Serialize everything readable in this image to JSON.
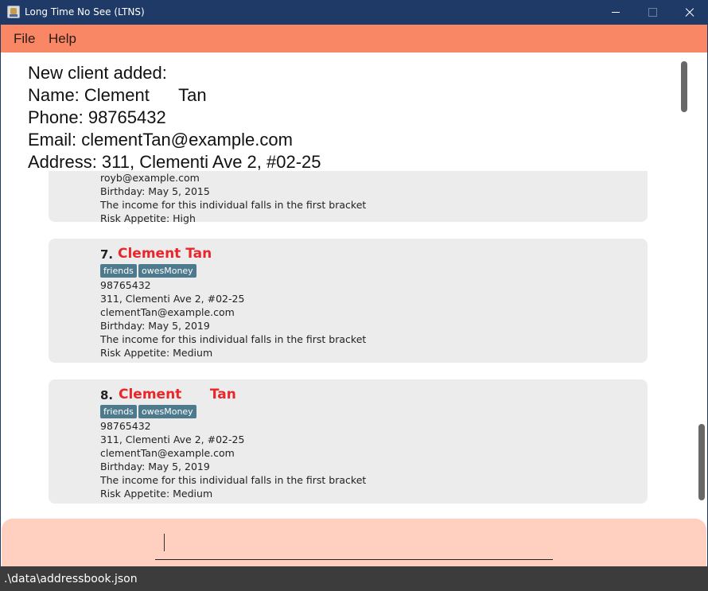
{
  "window": {
    "title": "Long Time No See (LTNS)"
  },
  "menu": {
    "file": "File",
    "help": "Help"
  },
  "result": {
    "text": "New client added:\nName: Clement      Tan\nPhone: 98765432\nEmail: clementTan@example.com\nAddress: 311, Clementi Ave 2, #02-25"
  },
  "persons": [
    {
      "email": "royb@example.com",
      "birthday": "Birthday: May 5, 2015",
      "income": "The income for this individual falls in the first bracket",
      "risk": "Risk Appetite: High"
    },
    {
      "index": "7.",
      "name": "Clement Tan",
      "tags": [
        "friends",
        "owesMoney"
      ],
      "phone": "98765432",
      "address": "311, Clementi Ave 2, #02-25",
      "email": "clementTan@example.com",
      "birthday": "Birthday: May 5, 2019",
      "income": "The income for this individual falls in the first bracket",
      "risk": "Risk Appetite: Medium"
    },
    {
      "index": "8.",
      "name": "Clement      Tan",
      "tags": [
        "friends",
        "owesMoney"
      ],
      "phone": "98765432",
      "address": "311, Clementi Ave 2, #02-25",
      "email": "clementTan@example.com",
      "birthday": "Birthday: May 5, 2019",
      "income": "The income for this individual falls in the first bracket",
      "risk": "Risk Appetite: Medium"
    }
  ],
  "command": {
    "value": ""
  },
  "status": {
    "path": ".\\data\\addressbook.json"
  },
  "colors": {
    "titlebar": "#1f3a66",
    "menubar": "#f98765",
    "card": "#ececec",
    "name": "#e9262a",
    "tag": "#4d7a8d",
    "command_box": "#ffcfc0",
    "statusbar": "#3c3c3c"
  },
  "icons": [
    "app-icon",
    "minimize-icon",
    "maximize-icon",
    "close-icon"
  ]
}
